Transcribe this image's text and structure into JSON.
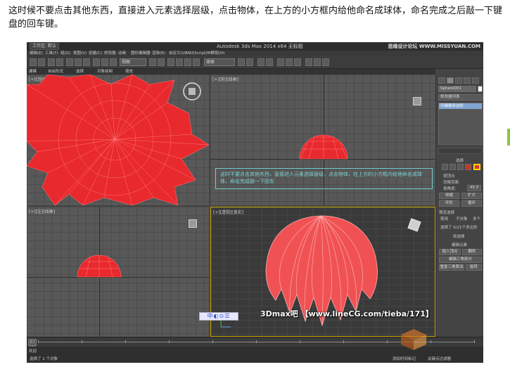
{
  "caption": "这时候不要点击其他东西，直接进入元素选择层级，点击物体，在上方的小方框内给他命名成球体，命名完成之后敲一下键盘的回车键。",
  "app": {
    "workspace_label": "工作区: 默认",
    "window_title": "Autodesk 3ds Max  2014 x64    无标题",
    "watermark_top": "思缘设计论坛 WWW.MISSYUAN.COM"
  },
  "menu": {
    "items": [
      "编辑(E)",
      "工具(T)",
      "组(G)",
      "视图(V)",
      "创建(C)",
      "修改器",
      "动画",
      "图形编辑器",
      "渲染(R)",
      "自定义(U)",
      "MAXScript(M)",
      "帮助(H)"
    ]
  },
  "toolbar": {
    "view_combo": "视图",
    "selection_set": "球体"
  },
  "ribbon": {
    "tabs": [
      "建模",
      "自由形式",
      "选择",
      "对象绘制",
      "填充"
    ],
    "mode_label": "多边形建模"
  },
  "viewports": {
    "top_label": "[+][顶][线框]",
    "front_label": "[+][前][线框]",
    "left_label": "[+][左][线框]",
    "persp_label": "[+][透视][真实]"
  },
  "annotation": "这时不要点击其他东西，直接进入元素选择层级，点击物体，在上方的小方框内给他命名成球体，命名完成敲一下回车",
  "panel": {
    "object_name": "Sphere001",
    "modifier_list": "修改器列表",
    "stack_item": "可编辑多边形",
    "rollout_selection": "选择",
    "by_vertex": "按顶点",
    "ignore_backfacing": "忽略背面",
    "by_angle": "按角度:",
    "angle_value": "45.0",
    "shrink": "收缩",
    "grow": "扩大",
    "ring": "环形",
    "loop": "循环",
    "preview_selection": "预览选择",
    "disabled": "禁用",
    "subobject": "子对象",
    "multiple": "多个",
    "selected_status": "选择了 6/21个多边形",
    "soft_selection": "软选择",
    "edit_elements": "编辑元素",
    "insert_vertex": "插入顶点",
    "flip": "翻转",
    "edit_triangulation": "编辑三角剖分",
    "retriangulate": "重复三角算法",
    "rotate": "旋转"
  },
  "timeline": {
    "frame": "0 / 100",
    "ticks": [
      "0",
      "10",
      "20",
      "30",
      "40",
      "50",
      "60",
      "70",
      "80",
      "90",
      "100"
    ]
  },
  "status": {
    "script_label": "欢迎",
    "selection_info": "选择了 1 个对象",
    "add_time_tag": "添加时间标记",
    "key_filter": "关键点过滤器"
  },
  "bottom_tools": "中◐⊙☰",
  "site_watermark": "3Dmax吧 【www.lineCG.com/tieba/171】"
}
